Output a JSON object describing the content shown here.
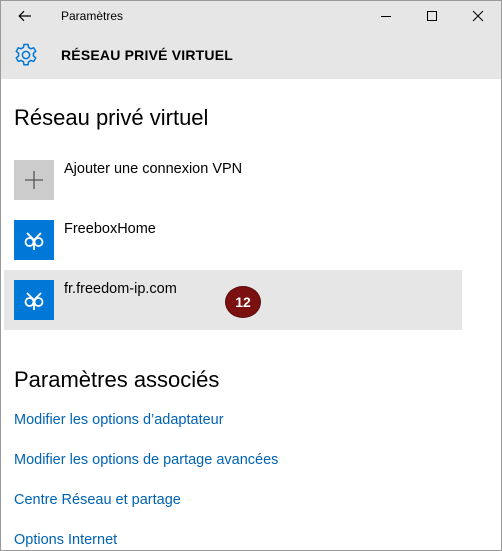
{
  "window": {
    "title": "Paramètres",
    "back_icon": "arrow-left-icon",
    "minimize_icon": "minimize-icon",
    "maximize_icon": "maximize-icon",
    "close_icon": "close-icon"
  },
  "header": {
    "icon": "gear-icon",
    "title": "RÉSEAU PRIVÉ VIRTUEL"
  },
  "vpn_section": {
    "title": "Réseau privé virtuel",
    "add_connection": {
      "icon": "plus-icon",
      "label": "Ajouter une connexion VPN"
    },
    "connections": [
      {
        "icon": "vpn-icon",
        "name": "FreeboxHome",
        "selected": false
      },
      {
        "icon": "vpn-icon",
        "name": "fr.freedom-ip.com",
        "selected": true
      }
    ],
    "annotation_badge": "12"
  },
  "related_section": {
    "title": "Paramètres associés",
    "links": [
      "Modifier les options d’adaptateur",
      "Modifier les options de partage avancées",
      "Centre Réseau et partage",
      "Options Internet"
    ]
  },
  "colors": {
    "accent": "#0078d7",
    "link": "#0063b1",
    "chrome": "#e6e6e6",
    "badge": "#7b1010"
  }
}
